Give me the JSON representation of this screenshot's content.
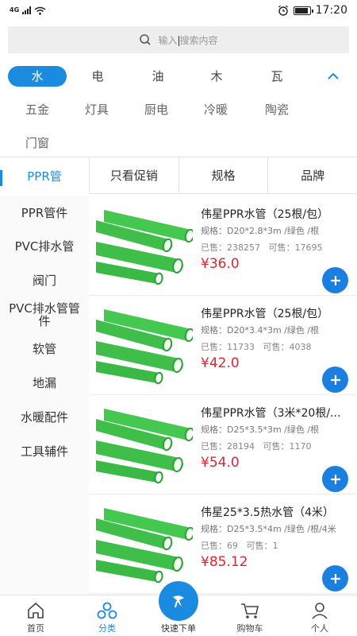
{
  "status_bar": {
    "network": "4G",
    "time": "17:20",
    "battery_level": 0.9
  },
  "search": {
    "placeholder_before": "输入",
    "placeholder_after": "搜索内容"
  },
  "categories": [
    "水",
    "电",
    "油",
    "木",
    "瓦"
  ],
  "sub_categories": [
    "五金",
    "灯具",
    "厨电",
    "冷暖",
    "陶瓷",
    "门窗"
  ],
  "sidebar": {
    "items": [
      "PPR管",
      "PPR管件",
      "PVC排水管",
      "阀门",
      "PVC排水管管件",
      "软管",
      "地漏",
      "水暖配件",
      "工具辅件"
    ]
  },
  "filters": [
    "只看促销",
    "规格",
    "品牌"
  ],
  "products": [
    {
      "title": "伟星PPR水管（25根/包）",
      "spec": "规格：D20*2.8*3m /绿色 /根",
      "sold_label": "已售：",
      "sold": "238257",
      "stock_label": "可售：",
      "stock": "17695",
      "price": "¥36.0"
    },
    {
      "title": "伟星PPR水管（25根/包）",
      "spec": "规格：D20*3.4*3m /绿色 /根",
      "sold_label": "已售：",
      "sold": "11733",
      "stock_label": "可售：",
      "stock": "4038",
      "price": "¥42.0"
    },
    {
      "title": "伟星PPR水管（3米*20根/...",
      "spec": "规格：D25*3.5*3m /绿色 /根",
      "sold_label": "已售：",
      "sold": "28194",
      "stock_label": "可售：",
      "stock": "1170",
      "price": "¥54.0"
    },
    {
      "title": "伟星25*3.5热水管（4米）",
      "spec": "规格：D25*3.5*4m /绿色 /根/4米",
      "sold_label": "已售：",
      "sold": "69",
      "stock_label": "可售：",
      "stock": "1",
      "price": "¥85.12"
    }
  ],
  "tabbar": {
    "home": "首页",
    "category": "分类",
    "quick_order": "快速下单",
    "cart": "购物车",
    "profile": "个人"
  },
  "colors": {
    "accent": "#1b8be0",
    "price": "#d8282f",
    "pipe": "#3fbf4a"
  }
}
